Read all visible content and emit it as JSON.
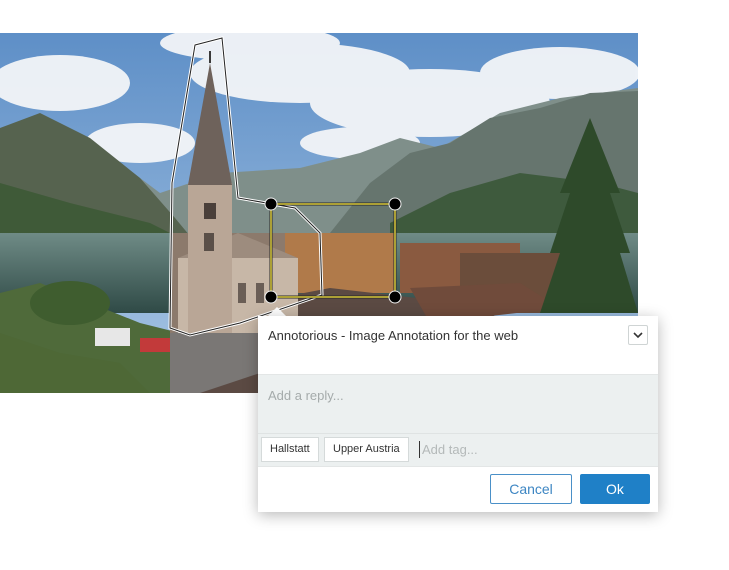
{
  "photo": {
    "subject": "Hallstatt lake village with church spire and mountains"
  },
  "annotation": {
    "comment": "Annotorious - Image Annotation for the web",
    "menu_icon": "chevron-down-icon"
  },
  "reply": {
    "placeholder": "Add a reply..."
  },
  "tags": {
    "items": [
      "Hallstatt",
      "Upper Austria"
    ],
    "placeholder": "Add tag..."
  },
  "buttons": {
    "cancel": "Cancel",
    "ok": "Ok"
  },
  "colors": {
    "accent": "#1f80c7",
    "selection_stroke": "#d7c83a",
    "handle": "#000000"
  }
}
